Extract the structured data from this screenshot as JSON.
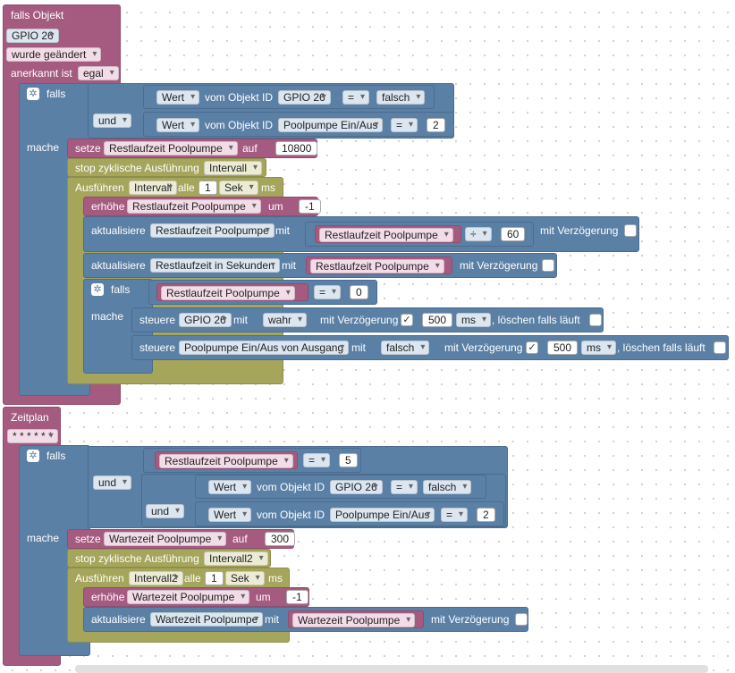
{
  "colors": {
    "event": "#a55b80",
    "logic": "#5b80a5",
    "timer": "#a5a55b",
    "workspace": "#ffffff"
  },
  "on_block": {
    "title": "falls Objekt",
    "object_id": "GPIO 26",
    "change_option": "wurde geändert",
    "ack_label": "anerkannt ist",
    "ack_option": "egal"
  },
  "if1": {
    "falls": "falls",
    "mache": "mache",
    "and": "und",
    "cond1": {
      "wert": "Wert",
      "vom": "vom Objekt ID",
      "obj": "GPIO 26",
      "op": "=",
      "val": "falsch"
    },
    "cond2": {
      "wert": "Wert",
      "vom": "vom Objekt ID",
      "obj": "Poolpumpe Ein/Aus",
      "op": "=",
      "val": "2"
    },
    "set": {
      "label": "setze",
      "var": "Restlaufzeit Poolpumpe",
      "auf": "auf",
      "val": "10800"
    },
    "stop": {
      "label": "stop zyklische Ausführung",
      "interval": "Intervall"
    },
    "exec": {
      "label": "Ausführen",
      "interval": "Intervall",
      "alle": "alle",
      "n": "1",
      "unit": "Sek",
      "ms": "ms"
    },
    "inc": {
      "label": "erhöhe",
      "var": "Restlaufzeit Poolpumpe",
      "um": "um",
      "val": "-1"
    },
    "upd1": {
      "label": "aktualisiere",
      "target": "Restlaufzeit Poolpumpe",
      "mit": "mit",
      "var": "Restlaufzeit Poolpumpe",
      "op": "÷",
      "val": "60",
      "delay": "mit Verzögerung"
    },
    "upd2": {
      "label": "aktualisiere",
      "target": "Restlaufzeit in Sekunden",
      "mit": "mit",
      "var": "Restlaufzeit Poolpumpe",
      "delay": "mit Verzögerung"
    },
    "inner_if": {
      "falls": "falls",
      "mache": "mache",
      "var": "Restlaufzeit Poolpumpe",
      "op": "=",
      "val": "0"
    },
    "ctrl1": {
      "label": "steuere",
      "obj": "GPIO 26",
      "mit": "mit",
      "val": "wahr",
      "delay": "mit Verzögerung",
      "check": "✓",
      "ms_val": "500",
      "unit": "ms",
      "clear": ", löschen falls läuft"
    },
    "ctrl2": {
      "label": "steuere",
      "obj": "Poolpumpe Ein/Aus von Ausgang",
      "mit": "mit",
      "val": "falsch",
      "delay": "mit Verzögerung",
      "check": "✓",
      "ms_val": "500",
      "unit": "ms",
      "clear": ", löschen falls läuft"
    }
  },
  "schedule": {
    "title": "Zeitplan",
    "cron": "* * * * * *"
  },
  "if2": {
    "falls": "falls",
    "mache": "mache",
    "and1": "und",
    "and2": "und",
    "cond1": {
      "var": "Restlaufzeit Poolpumpe",
      "op": "=",
      "val": "5"
    },
    "cond2": {
      "wert": "Wert",
      "vom": "vom Objekt ID",
      "obj": "GPIO 26",
      "op": "=",
      "val": "falsch"
    },
    "cond3": {
      "wert": "Wert",
      "vom": "vom Objekt ID",
      "obj": "Poolpumpe Ein/Aus",
      "op": "=",
      "val": "2"
    },
    "set": {
      "label": "setze",
      "var": "Wartezeit Poolpumpe",
      "auf": "auf",
      "val": "300"
    },
    "stop": {
      "label": "stop zyklische Ausführung",
      "interval": "Intervall2"
    },
    "exec": {
      "label": "Ausführen",
      "interval": "Intervall2",
      "alle": "alle",
      "n": "1",
      "unit": "Sek",
      "ms": "ms"
    },
    "inc": {
      "label": "erhöhe",
      "var": "Wartezeit Poolpumpe",
      "um": "um",
      "val": "-1"
    },
    "upd": {
      "label": "aktualisiere",
      "target": "Wartezeit Poolpumpe",
      "mit": "mit",
      "var": "Wartezeit Poolpumpe",
      "delay": "mit Verzögerung"
    }
  }
}
